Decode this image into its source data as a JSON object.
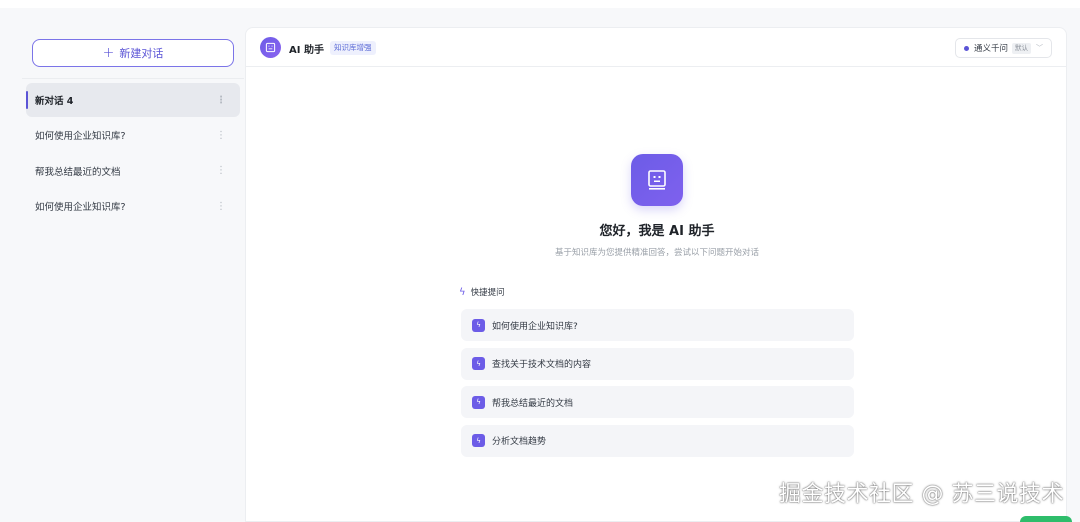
{
  "sidebar": {
    "new_chat_label": "新建对话",
    "conversations": [
      {
        "title": "新对话 4",
        "active": true
      },
      {
        "title": "如何使用企业知识库?",
        "active": false
      },
      {
        "title": "帮我总结最近的文档",
        "active": false
      },
      {
        "title": "如何使用企业知识库?",
        "active": false
      }
    ],
    "more_icon": "more-vertical-icon"
  },
  "header": {
    "title": "AI 助手",
    "badge": "知识库增强",
    "model": {
      "name": "通义千问",
      "tag": "默认"
    }
  },
  "welcome": {
    "title": "您好，我是 AI 助手",
    "subtitle": "基于知识库为您提供精准回答，尝试以下问题开始对话",
    "quick_label": "快捷提问",
    "quick_questions": [
      "如何使用企业知识库?",
      "查找关于技术文档的内容",
      "帮我总结最近的文档",
      "分析文档趋势"
    ]
  },
  "watermark": "掘金技术社区 @ 苏三说技术",
  "colors": {
    "accent": "#6c5ce7",
    "active_bg": "#e7e9ee"
  }
}
